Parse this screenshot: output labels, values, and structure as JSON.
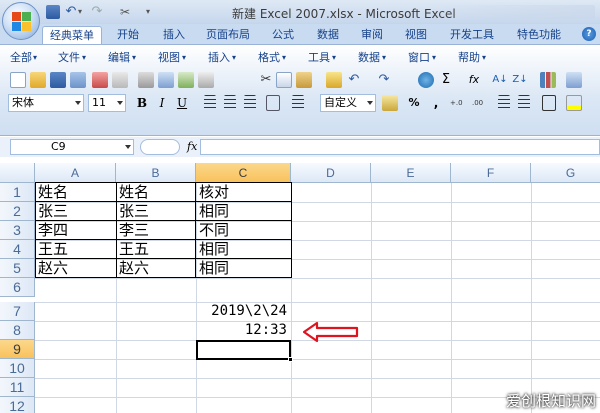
{
  "window": {
    "title": "新建 Excel 2007.xlsx - Microsoft Excel"
  },
  "ribbon_tabs": [
    "经典菜单",
    "开始",
    "插入",
    "页面布局",
    "公式",
    "数据",
    "审阅",
    "视图",
    "开发工具",
    "特色功能"
  ],
  "help_label": "?",
  "menus": [
    "全部",
    "文件",
    "编辑",
    "视图",
    "插入",
    "格式",
    "工具",
    "数据",
    "窗口",
    "帮助"
  ],
  "toolbar": {
    "font_name": "宋体",
    "font_size": "11",
    "bold": "B",
    "italic": "I",
    "underline": "U",
    "number_format": "自定义",
    "percent": "%",
    "comma": ",",
    "sigma": "Σ",
    "fx": "fx"
  },
  "formula_bar": {
    "name_box": "C9",
    "fx_label": "fx",
    "formula": ""
  },
  "columns": [
    "A",
    "B",
    "C",
    "D",
    "E",
    "F",
    "G"
  ],
  "rows": [
    "1",
    "2",
    "3",
    "4",
    "5",
    "6",
    "7",
    "8",
    "9",
    "10",
    "11",
    "12"
  ],
  "cells": {
    "A1": "姓名",
    "B1": "姓名",
    "C1": "核对",
    "A2": "张三",
    "B2": "张三",
    "C2": "相同",
    "A3": "李四",
    "B3": "李三",
    "C3": "不同",
    "A4": "王五",
    "B4": "王五",
    "C4": "相同",
    "A5": "赵六",
    "B5": "赵六",
    "C5": "相同",
    "C7": "2019\\2\\24",
    "C8": "12:33"
  },
  "selected_cell": "C9",
  "watermark": "爱创根知识网",
  "colors": {
    "arrow": "#e0141e",
    "selected_header": "#f9c25c",
    "ribbon_blue": "#c9dbf0"
  }
}
